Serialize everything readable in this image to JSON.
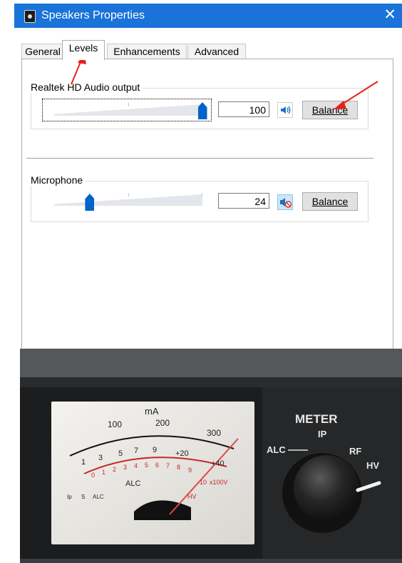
{
  "window": {
    "title": "Speakers Properties",
    "close_glyph": "✕"
  },
  "tabs": [
    {
      "label": "General",
      "active": false
    },
    {
      "label": "Levels",
      "active": true
    },
    {
      "label": "Enhancements",
      "active": false
    },
    {
      "label": "Advanced",
      "active": false
    }
  ],
  "groups": [
    {
      "label": "Realtek HD Audio output",
      "level": 100,
      "value_text": "100",
      "muted": false,
      "balance_label": "Balance",
      "speaker_icon": "speaker-volume-icon"
    },
    {
      "label": "Microphone",
      "level": 24,
      "value_text": "24",
      "muted": true,
      "balance_label": "Balance",
      "speaker_icon": "speaker-muted-icon"
    }
  ],
  "annotations": {
    "arrow_color": "#e8201a"
  },
  "meter_photo": {
    "unit_top": "mA",
    "scale_top": [
      "100",
      "200",
      "300"
    ],
    "scale_black": [
      "1",
      "3",
      "5",
      "7",
      "9",
      "+20",
      "+40"
    ],
    "scale_red": [
      "0",
      "1",
      "2",
      "3",
      "4",
      "5",
      "6",
      "7",
      "8",
      "9",
      "10"
    ],
    "red_suffix": "x100V",
    "alc_label": "ALC",
    "hv_label": "HV",
    "bottom_labels": [
      "Ip",
      "S",
      "ALC"
    ],
    "panel_title": "METER",
    "switch_positions": [
      "IP",
      "ALC",
      "RF",
      "HV"
    ]
  },
  "colors": {
    "titlebar": "#1a73d9",
    "slider_thumb": "#0063c9",
    "annotation_red": "#e8201a"
  }
}
